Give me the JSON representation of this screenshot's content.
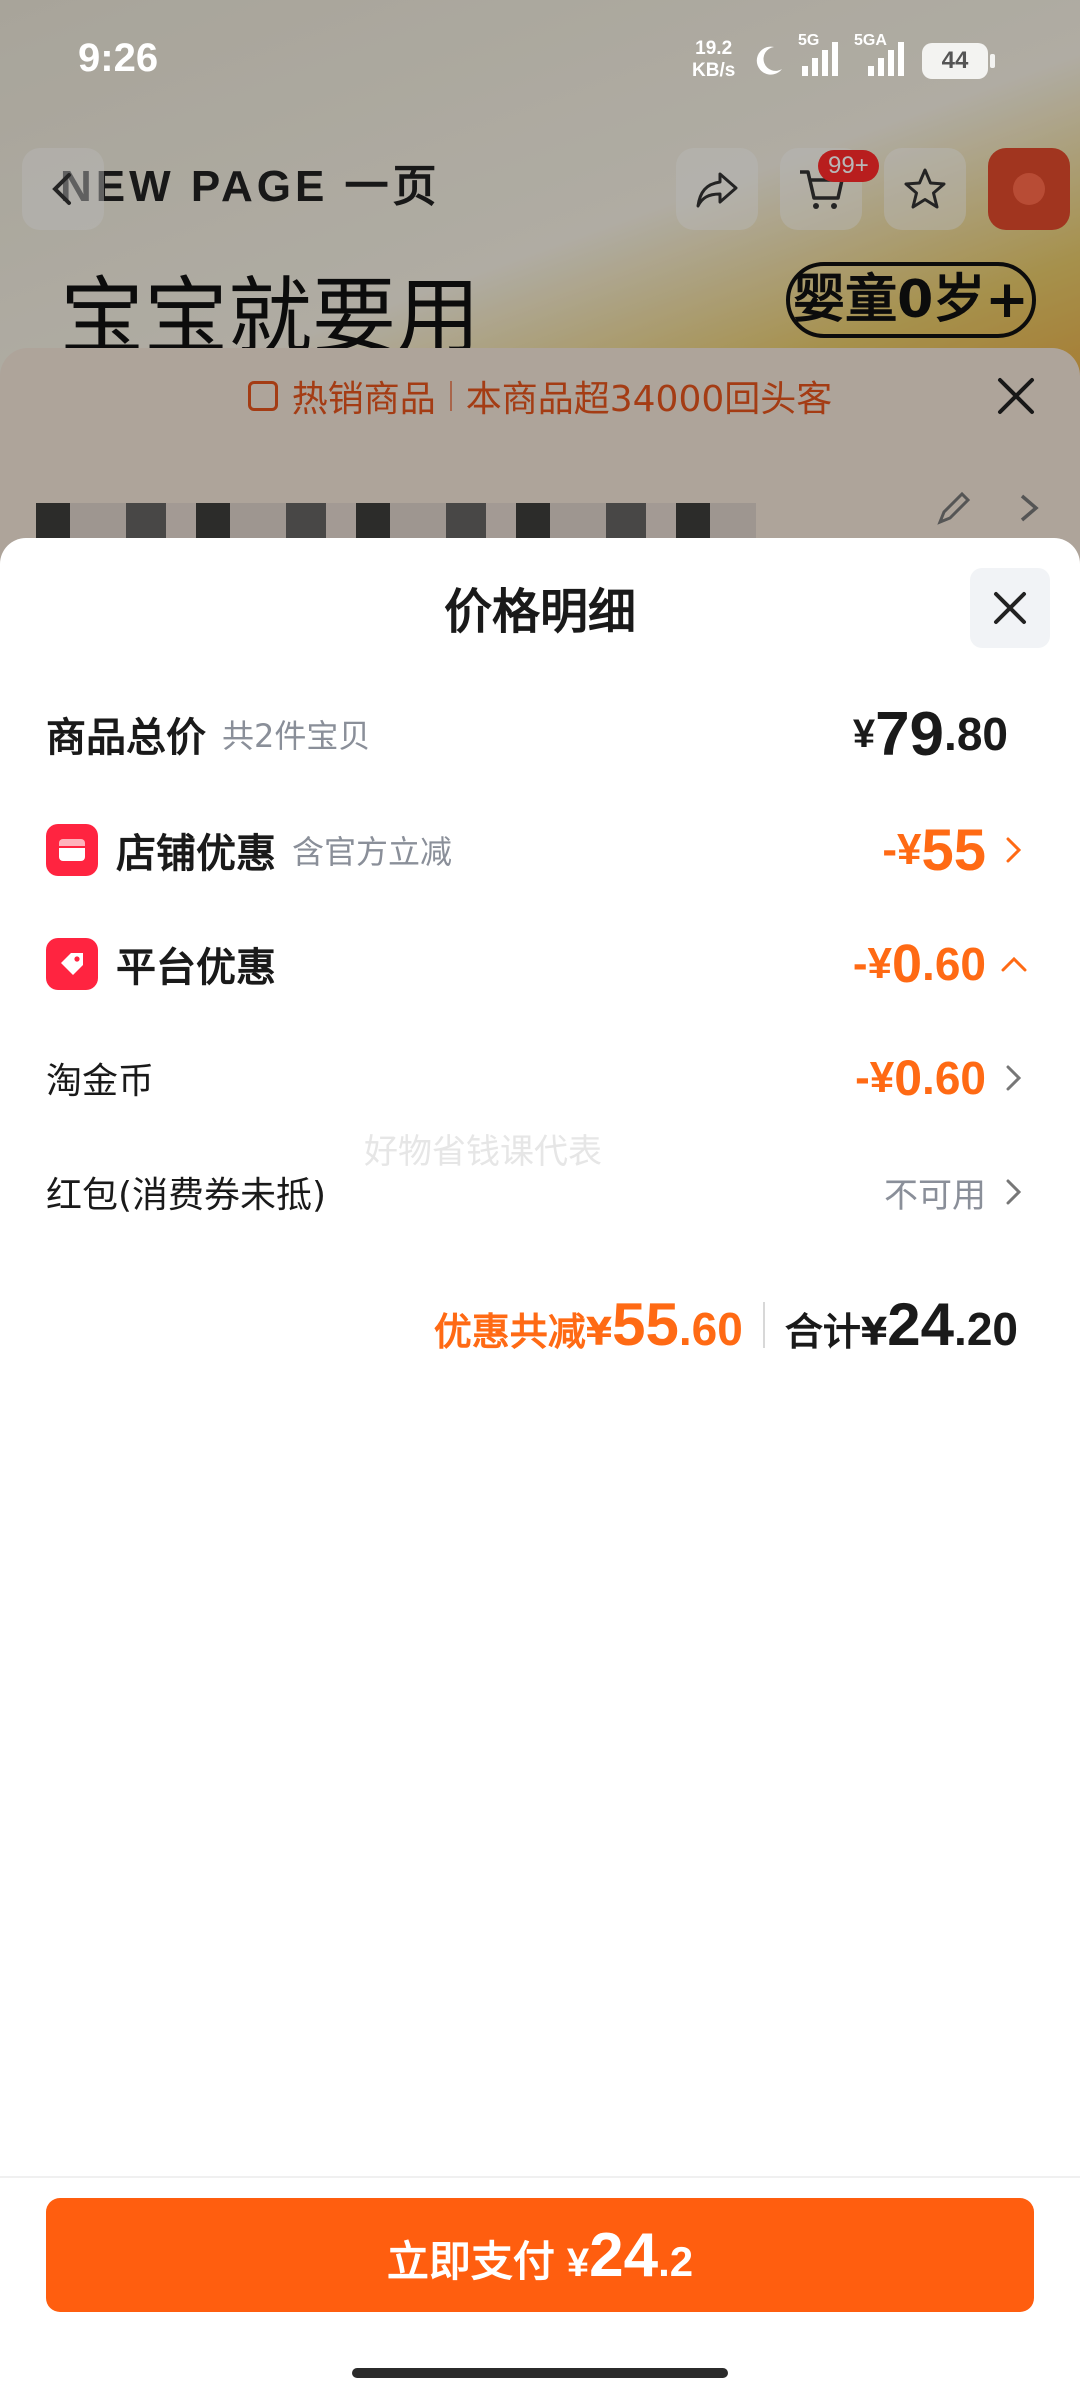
{
  "status_bar": {
    "time": "9:26",
    "net_speed_value": "19.2",
    "net_speed_unit": "KB/s",
    "net1": "5G",
    "net2": "5GA",
    "battery": "44"
  },
  "background": {
    "brand": "NEW PAGE 一页",
    "headline": "宝宝就要用",
    "age_tag": "婴童0岁+",
    "cart_badge": "99+"
  },
  "hot_banner": {
    "left": "热销商品",
    "right": "本商品超34000回头客"
  },
  "sheet": {
    "title": "价格明细",
    "total": {
      "label": "商品总价",
      "sub": "共2件宝贝",
      "currency": "¥",
      "int": "79",
      "dec": ".80"
    },
    "store_discount": {
      "label": "店铺优惠",
      "sub": "含官方立减",
      "prefix": "-¥",
      "int": "55",
      "dec": ""
    },
    "platform_discount": {
      "label": "平台优惠",
      "prefix": "-¥",
      "int": "0",
      "dec": ".60"
    },
    "taojinbi": {
      "label": "淘金币",
      "prefix": "-¥",
      "int": "0",
      "dec": ".60"
    },
    "red_packet": {
      "label": "红包(消费券未抵)",
      "value": "不可用"
    },
    "summary": {
      "discount_label": "优惠共减¥",
      "discount_int": "55",
      "discount_dec": ".60",
      "total_label": "合计¥",
      "total_int": "24",
      "total_dec": ".20"
    },
    "watermark": "好物省钱课代表"
  },
  "pay_button": {
    "label": "立即支付",
    "currency": "¥",
    "int": "24",
    "dec": ".2"
  },
  "colors": {
    "accent_orange": "#ff6a14",
    "pay_button": "#ff5e0f",
    "icon_red": "#ff2440"
  }
}
